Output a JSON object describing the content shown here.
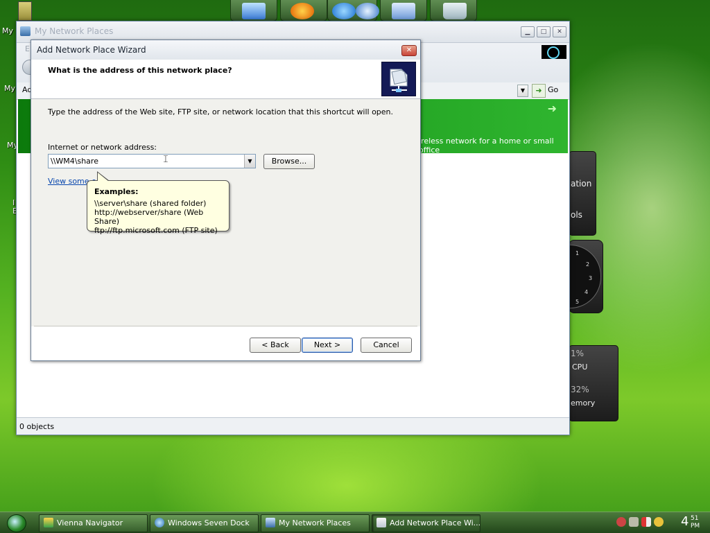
{
  "desktop": {
    "labels": [
      "My",
      "My",
      "My",
      "I",
      "E"
    ],
    "green_band_text": "ireless network for a home or small office",
    "gadgets": {
      "location_text": "ation",
      "tools_text": "ols",
      "cpu_label": "CPU",
      "cpu_value": "1%",
      "memory_label": "emory",
      "memory_value": "32%",
      "clock_numbers": [
        "1",
        "2",
        "3",
        "4",
        "5"
      ]
    }
  },
  "explorer": {
    "title": "My Network Places",
    "menu_partial": "E",
    "address_partial": "Ad",
    "go_label": "Go",
    "status_text": "0 objects"
  },
  "dialog": {
    "title": "Add Network Place Wizard",
    "heading": "What is the address of this network place?",
    "instruction": "Type the address of the Web site, FTP site, or network location that this shortcut will open.",
    "address_label": "Internet or network address:",
    "address_value": "\\\\WM4\\share",
    "browse_label": "Browse...",
    "examples_link": "View some e",
    "tooltip": {
      "heading": "Examples:",
      "lines": [
        "\\\\server\\share   (shared folder)",
        "http://webserver/share   (Web Share)",
        "ftp://ftp.microsoft.com   (FTP site)"
      ]
    },
    "back_label": "< Back",
    "next_label": "Next >",
    "cancel_label": "Cancel"
  },
  "taskbar": {
    "items": [
      "Vienna Navigator",
      "Windows Seven Dock",
      "My Network Places",
      "Add Network Place Wi..."
    ],
    "active_index": 3,
    "clock_hour": "4",
    "clock_minute": "51",
    "clock_suffix": "PM"
  },
  "colors": {
    "desktop": "#3d9a18",
    "tooltip": "#ffffe1",
    "link": "#0645ad"
  }
}
